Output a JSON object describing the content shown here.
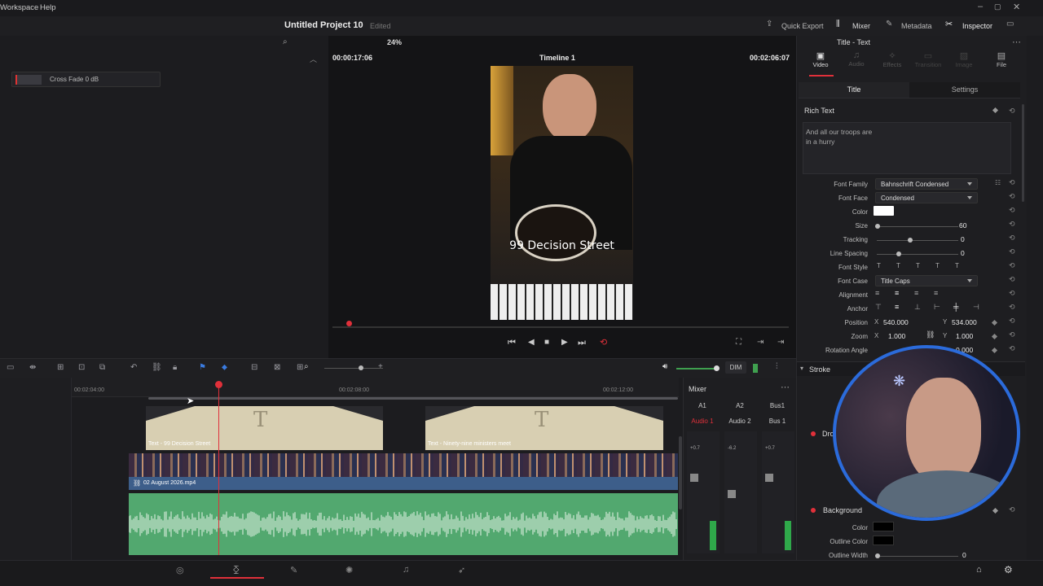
{
  "menu": {
    "workspace": "Workspace",
    "help": "Help"
  },
  "window": {
    "project_title": "Untitled Project 10",
    "status": "Edited"
  },
  "header": {
    "quick_export": "Quick Export",
    "mixer": "Mixer",
    "metadata": "Metadata",
    "inspector": "Inspector"
  },
  "viewer": {
    "zoom": "24%",
    "timecode_left": "00:00:17:06",
    "timeline_name": "Timeline 1",
    "timecode_right": "00:02:06:07",
    "overlay_text": "99 Decision Street"
  },
  "effects": {
    "item_label": "Cross Fade 0 dB"
  },
  "inspector": {
    "clip_title": "Title - Text",
    "tabs": [
      "Video",
      "Audio",
      "Effects",
      "Transition",
      "Image",
      "File"
    ],
    "subtabs": {
      "title": "Title",
      "settings": "Settings"
    },
    "rich_text_label": "Rich Text",
    "rich_text_value": "And all our troops are in a hurry",
    "font_family_label": "Font Family",
    "font_family": "Bahnschrift Condensed",
    "font_face_label": "Font Face",
    "font_face": "Condensed",
    "color_label": "Color",
    "color_value": "#ffffff",
    "size_label": "Size",
    "size": "60",
    "tracking_label": "Tracking",
    "tracking": "0",
    "line_spacing_label": "Line Spacing",
    "line_spacing": "0",
    "font_style_label": "Font Style",
    "font_case_label": "Font Case",
    "font_case": "Title Caps",
    "alignment_label": "Alignment",
    "anchor_label": "Anchor",
    "position_label": "Position",
    "pos_x_label": "X",
    "pos_x": "540.000",
    "pos_y_label": "Y",
    "pos_y": "534.000",
    "zoom_label": "Zoom",
    "zoom_x_label": "X",
    "zoom_x": "1.000",
    "zoom_y_label": "Y",
    "zoom_y": "1.000",
    "rotation_label": "Rotation Angle",
    "rotation": "0.000",
    "stroke_label": "Stroke",
    "drop_label": "Dro",
    "background_label": "Background",
    "bg_color_label": "Color",
    "bg_outline_label": "Outline Color",
    "bg_outline_width_label": "Outline Width",
    "bg_outline_width": "0"
  },
  "timeline": {
    "ruler": [
      "00:02:04:00",
      "00:02:08:00",
      "00:02:12:00"
    ],
    "clip_title_1": "Text - 99 Decision Street",
    "clip_title_2": "Text - Ninety-nine ministers meet",
    "video_clip": "02 August 2026.mp4",
    "dim": "DIM"
  },
  "mixer": {
    "title": "Mixer",
    "channels": [
      "A1",
      "A2",
      "Bus1"
    ],
    "names": [
      "Audio 1",
      "Audio 2",
      "Bus 1"
    ],
    "levels": [
      "+0.7",
      "-6.2",
      "+0.7"
    ]
  },
  "colors": {
    "accent": "#e0303a",
    "clip_title": "#d9d0b3",
    "audio_green": "#52a86f",
    "video_track": "#3d5e8a"
  }
}
